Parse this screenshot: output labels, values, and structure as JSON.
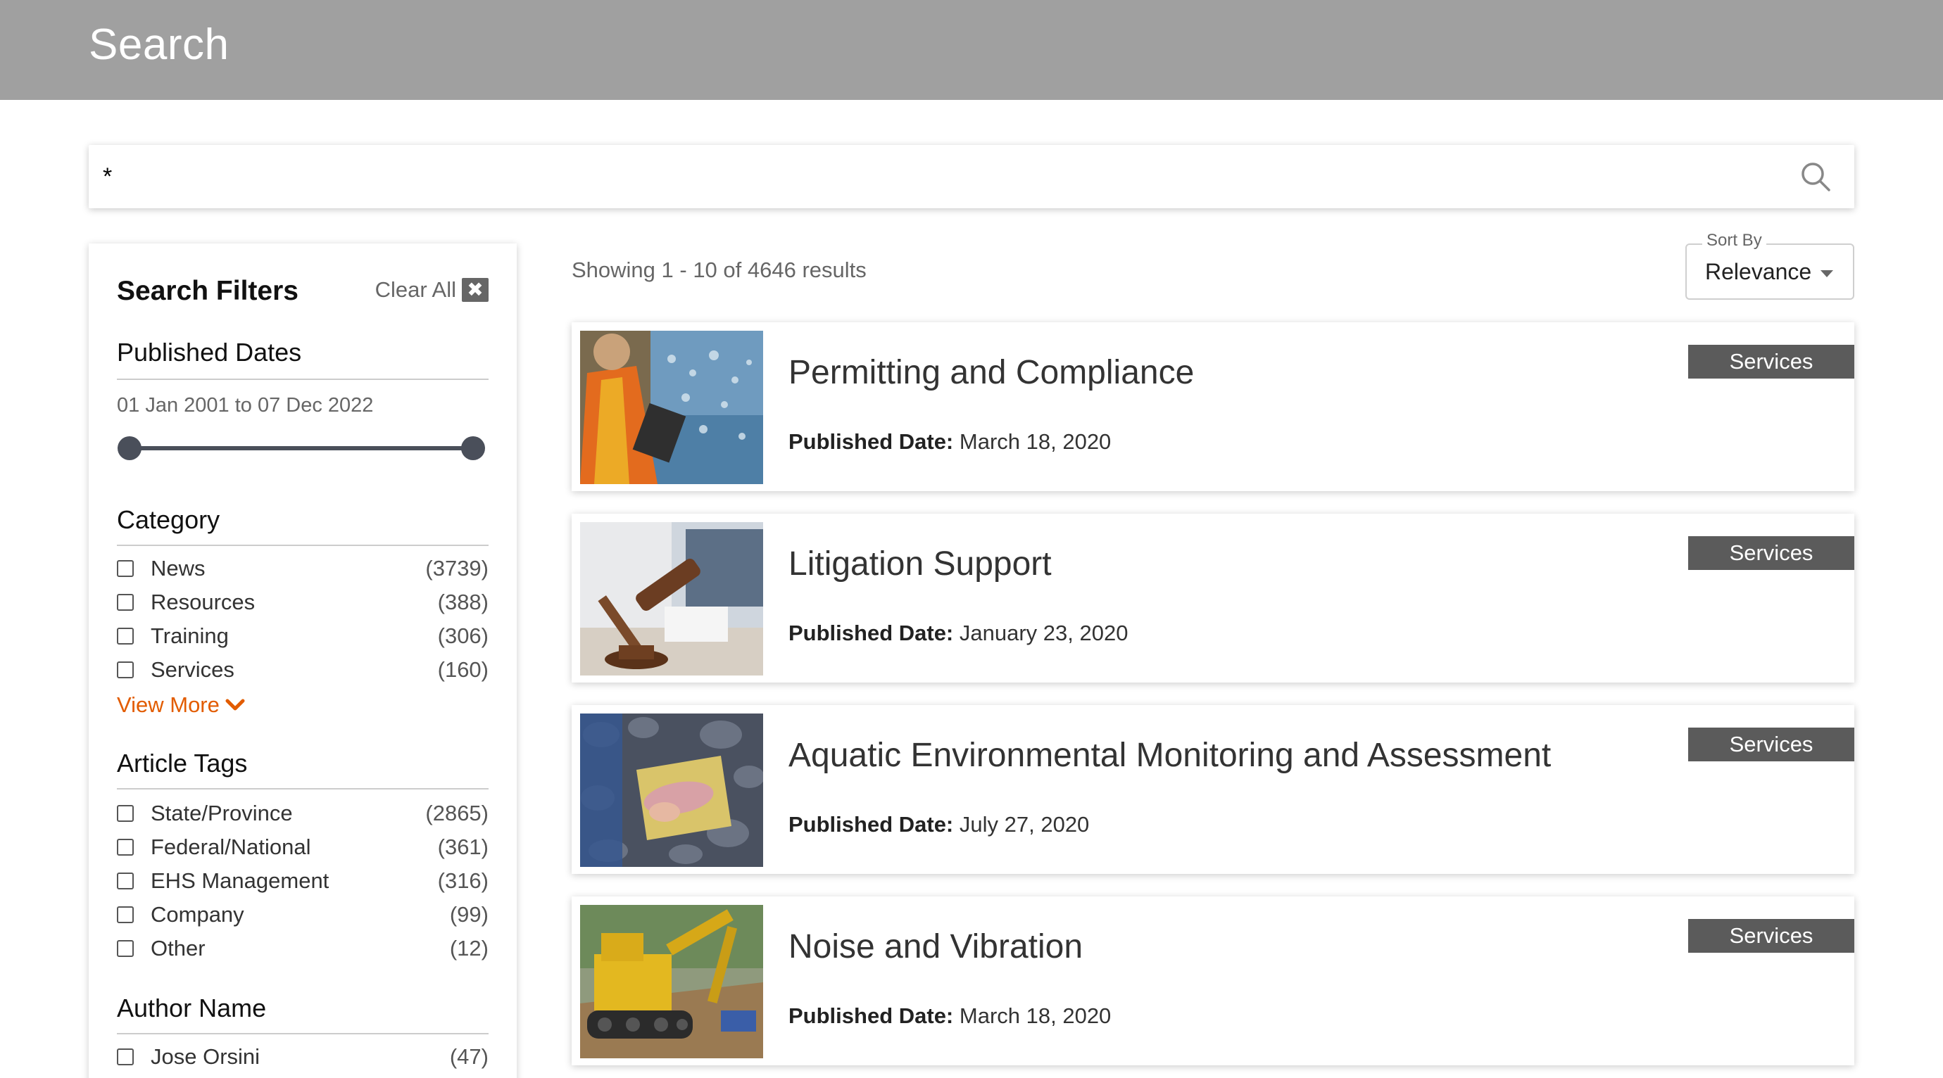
{
  "header": {
    "title": "Search"
  },
  "search": {
    "value": "*",
    "placeholder": ""
  },
  "filters": {
    "title": "Search Filters",
    "clear_all": "Clear All",
    "clear_icon": "✖",
    "published_dates": {
      "title": "Published Dates",
      "range_text": "01 Jan 2001 to 07 Dec 2022",
      "range_start": 0,
      "range_end": 1
    },
    "category": {
      "title": "Category",
      "items": [
        {
          "label": "News",
          "count": "(3739)"
        },
        {
          "label": "Resources",
          "count": "(388)"
        },
        {
          "label": "Training",
          "count": "(306)"
        },
        {
          "label": "Services",
          "count": "(160)"
        }
      ],
      "view_more": "View More"
    },
    "article_tags": {
      "title": "Article Tags",
      "items": [
        {
          "label": "State/Province",
          "count": "(2865)"
        },
        {
          "label": "Federal/National",
          "count": "(361)"
        },
        {
          "label": "EHS Management",
          "count": "(316)"
        },
        {
          "label": "Company",
          "count": "(99)"
        },
        {
          "label": "Other",
          "count": "(12)"
        }
      ]
    },
    "author_name": {
      "title": "Author Name",
      "items": [
        {
          "label": "Jose Orsini",
          "count": "(47)"
        }
      ]
    }
  },
  "results": {
    "summary": "Showing 1 - 10 of 4646 results",
    "sort": {
      "label": "Sort By",
      "value": "Relevance"
    },
    "date_label": "Published Date:",
    "items": [
      {
        "title": "Permitting and Compliance",
        "date": "March 18, 2020",
        "badge": "Services"
      },
      {
        "title": "Litigation Support",
        "date": "January 23, 2020",
        "badge": "Services"
      },
      {
        "title": "Aquatic Environmental Monitoring and Assessment",
        "date": "July 27, 2020",
        "badge": "Services"
      },
      {
        "title": "Noise and Vibration",
        "date": "March 18, 2020",
        "badge": "Services"
      }
    ]
  },
  "colors": {
    "header_bg": "#a0a0a0",
    "accent": "#e25c00",
    "badge_bg": "#5b5b5b",
    "slider": "#4a4f5a"
  }
}
